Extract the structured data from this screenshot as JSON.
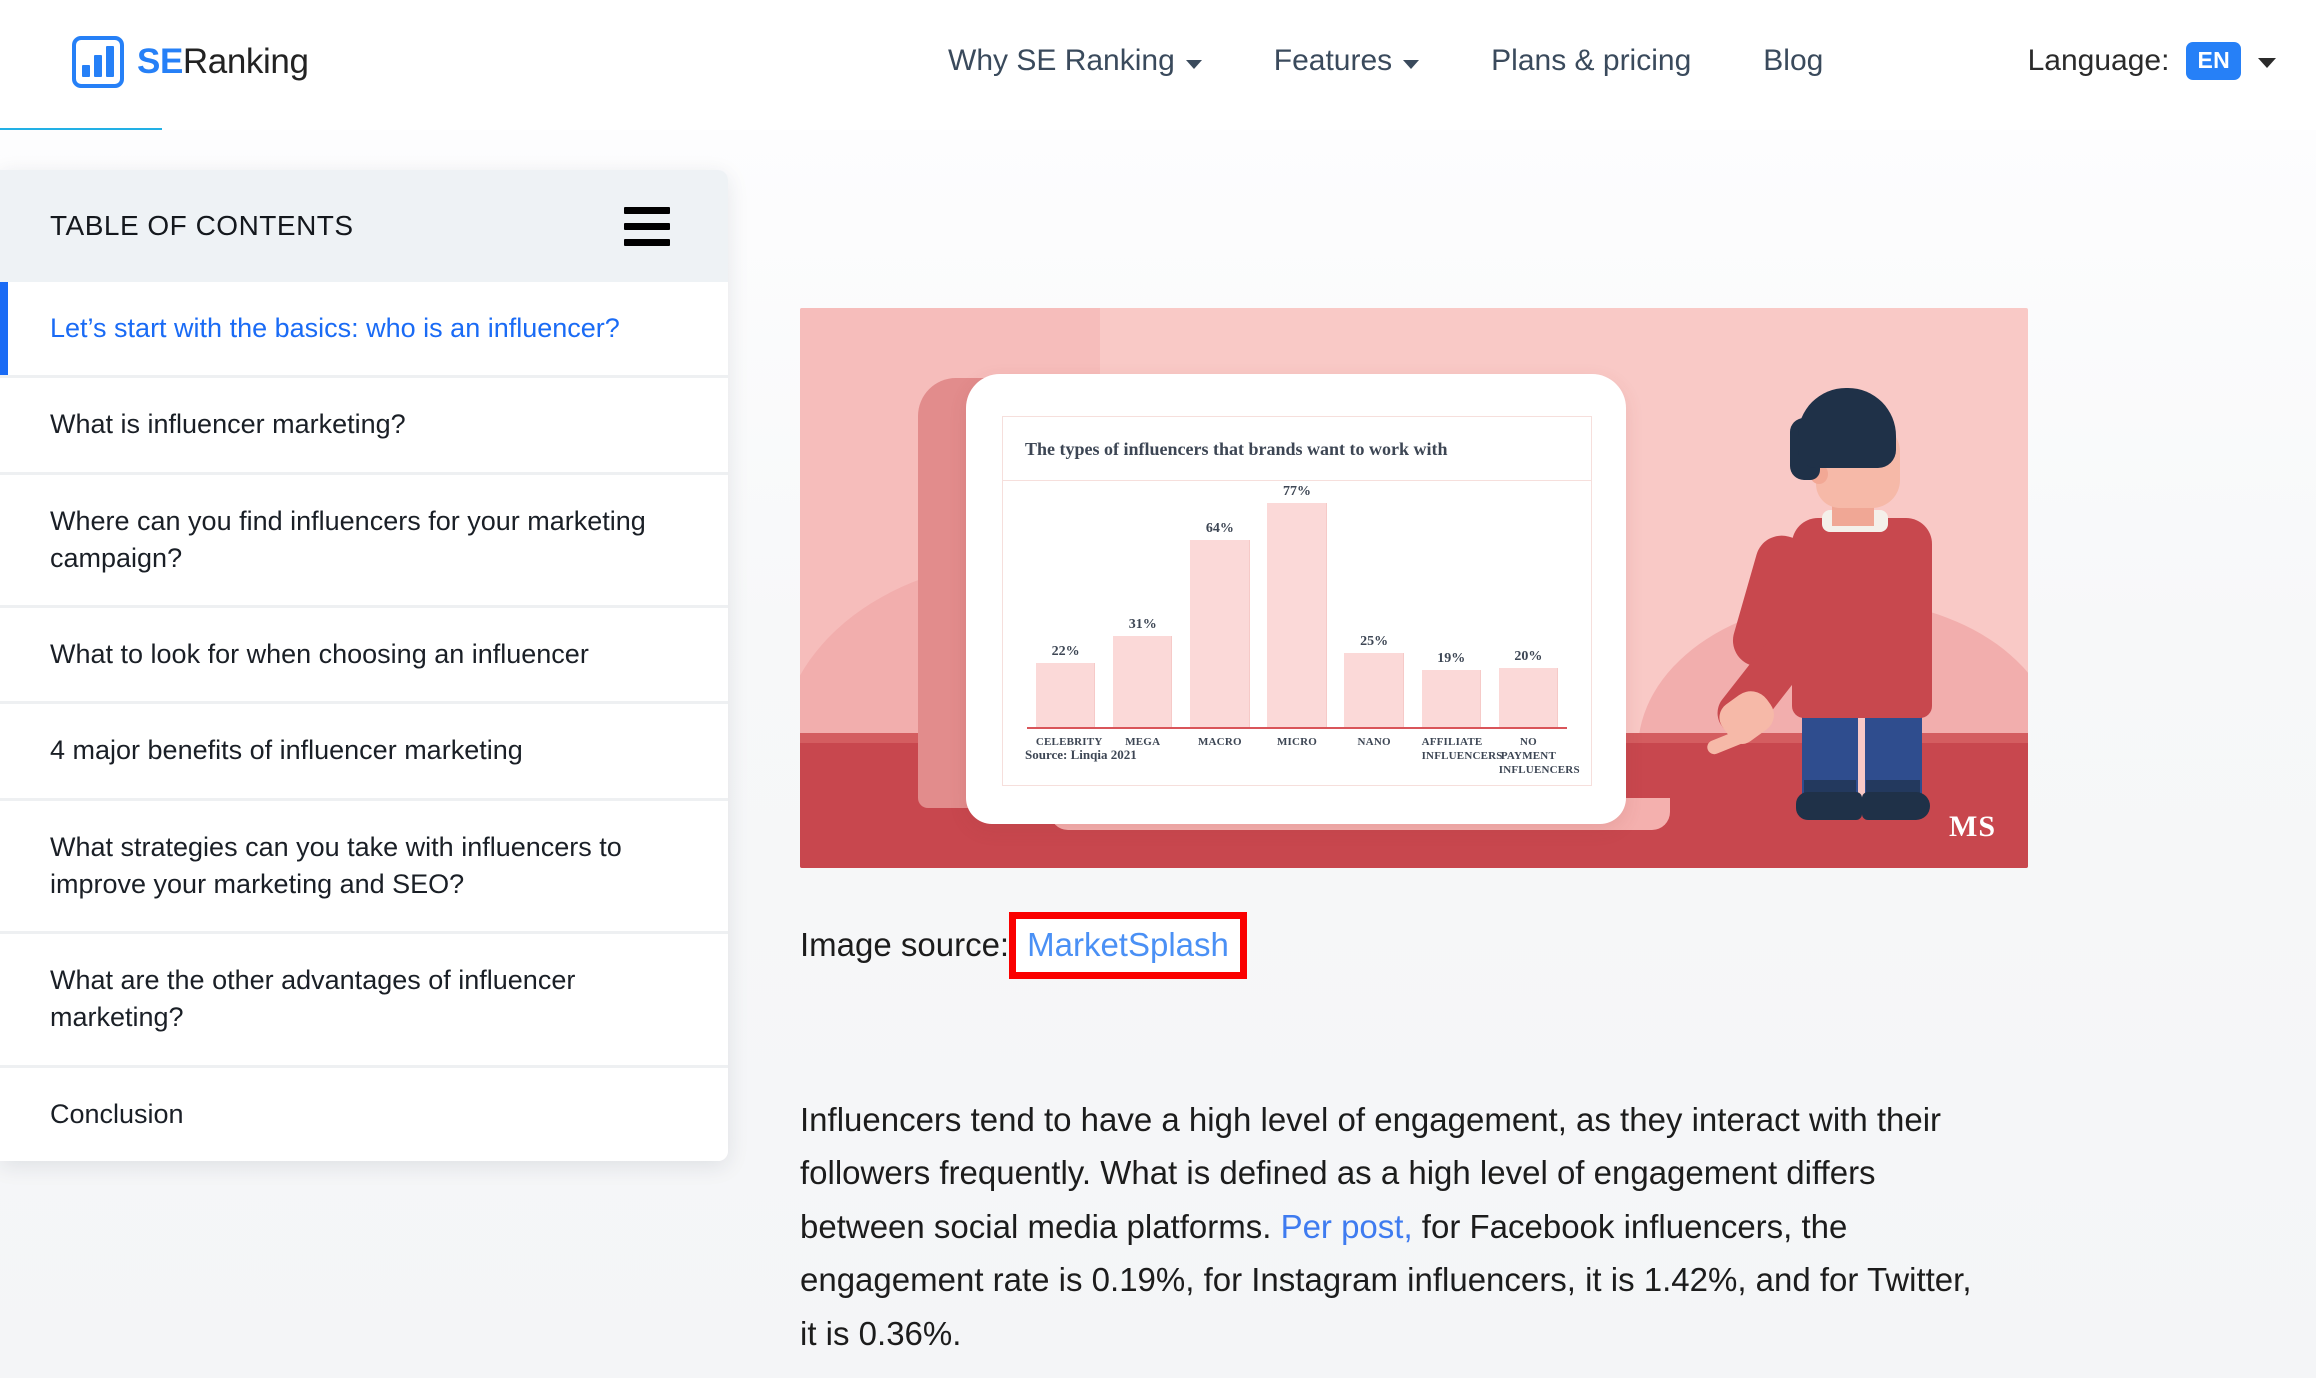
{
  "header": {
    "logo": {
      "se": "SE",
      "ranking": "Ranking"
    },
    "nav": [
      {
        "label": "Why SE Ranking",
        "has_caret": true
      },
      {
        "label": "Features",
        "has_caret": true
      },
      {
        "label": "Plans & pricing",
        "has_caret": false
      },
      {
        "label": "Blog",
        "has_caret": false
      }
    ],
    "language": {
      "label": "Language:",
      "value": "EN"
    },
    "accent_color": "#2680f7"
  },
  "read_progress": {
    "percent": 7,
    "color": "#22b0e5"
  },
  "toc": {
    "title": "TABLE OF CONTENTS",
    "active_index": 0,
    "active_color": "#1a6bf5",
    "items": [
      {
        "label": "Let’s start with the basics: who is an influencer?"
      },
      {
        "label": "What is influencer marketing?"
      },
      {
        "label": "Where can you find influencers for your marketing campaign?"
      },
      {
        "label": "What to look for when choosing an influencer"
      },
      {
        "label": "4 major benefits of influencer marketing"
      },
      {
        "label": "What strategies can you take with influencers to improve your marketing and SEO?"
      },
      {
        "label": "What are the other advantages of influencer marketing?"
      },
      {
        "label": "Conclusion"
      }
    ]
  },
  "article": {
    "image_source_label": "Image source:",
    "image_source_link": "MarketSplash",
    "image_source_highlight_color": "#fa0000",
    "illustration_watermark": "MS",
    "paragraph_part1": "Influencers tend to have a high level of engagement, as they interact with their followers frequently. What is defined as a high level of engagement differs between social media platforms. ",
    "paragraph_link": "Per post,",
    "paragraph_part2": " for Facebook influencers, the engagement rate is 0.19%, for Instagram influencers, it is 1.42%, and for Twitter, it is 0.36%."
  },
  "chart_data": {
    "type": "bar",
    "title": "The types of influencers that brands want to work with",
    "source": "Source: Linqia 2021",
    "categories": [
      "CELEBRITY",
      "MEGA",
      "MACRO",
      "MICRO",
      "NANO",
      "AFFILIATE INFLUENCERS",
      "NO PAYMENT INFLUENCERS"
    ],
    "values": [
      22,
      31,
      64,
      77,
      25,
      19,
      20
    ],
    "value_labels": [
      "22%",
      "31%",
      "64%",
      "77%",
      "25%",
      "19%",
      "20%"
    ],
    "unit": "%",
    "xlabel": "",
    "ylabel": "",
    "ylim": [
      0,
      85
    ],
    "grid": false,
    "legend": "none",
    "bar_color": "#fbd9d8",
    "axis_color": "#d9555a"
  }
}
